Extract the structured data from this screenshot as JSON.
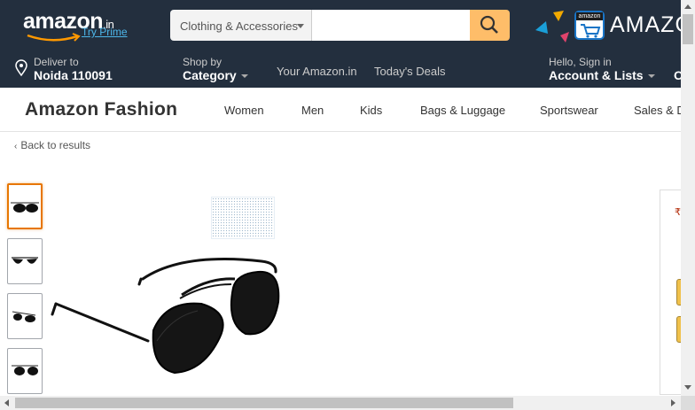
{
  "header": {
    "logo_text": "amazon",
    "logo_suffix": ".in",
    "try_prime": "Try Prime",
    "search_category": "Clothing & Accessories",
    "search_placeholder": "",
    "promo_text": "AMAZO",
    "app_icon_label": "amazon"
  },
  "nav": {
    "deliver_line1": "Deliver to",
    "deliver_line2": "Noida 110091",
    "shop_line1": "Shop by",
    "shop_line2": "Category",
    "your_amazon": "Your Amazon.in",
    "todays_deals": "Today's Deals",
    "account_line1": "Hello, Sign in",
    "account_line2": "Account & Lists",
    "cut_item": "O"
  },
  "subnav": {
    "title": "Amazon Fashion",
    "links": [
      "Women",
      "Men",
      "Kids",
      "Bags & Luggage",
      "Sportswear",
      "Sales & D"
    ]
  },
  "product": {
    "back_link": "Back to results",
    "buybox_rupee": "₹"
  },
  "colors": {
    "nav_bg": "#232f3e",
    "search_button": "#febd69",
    "thumb_active": "#e77600",
    "prime_link": "#4db6e9"
  }
}
